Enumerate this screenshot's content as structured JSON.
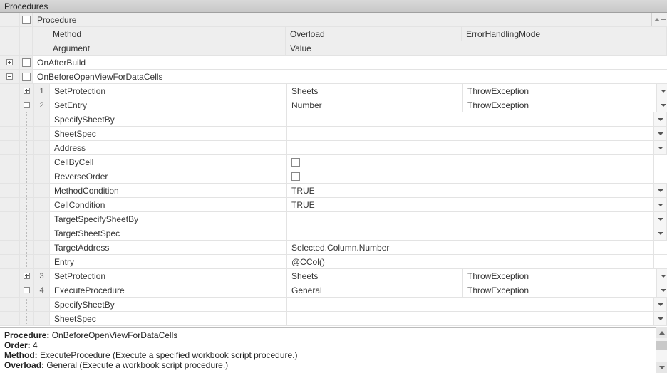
{
  "panel": {
    "title": "Procedures"
  },
  "headers": {
    "procedure": "Procedure",
    "method": "Method",
    "overload": "Overload",
    "error": "ErrorHandlingMode",
    "argument": "Argument",
    "value": "Value"
  },
  "groups": [
    {
      "name": "OnAfterBuild",
      "state": "collapsed",
      "checked": false
    },
    {
      "name": "OnBeforeOpenViewForDataCells",
      "state": "expanded",
      "checked": false
    }
  ],
  "steps": [
    {
      "num": "1",
      "method": "SetProtection",
      "overload": "Sheets",
      "error": "ThrowException",
      "state": "collapsed"
    },
    {
      "num": "2",
      "method": "SetEntry",
      "overload": "Number",
      "error": "ThrowException",
      "state": "expanded",
      "args": [
        {
          "name": "SpecifySheetBy",
          "value": "",
          "dd": true
        },
        {
          "name": "SheetSpec",
          "value": "",
          "dd": true
        },
        {
          "name": "Address",
          "value": "",
          "dd": true
        },
        {
          "name": "CellByCell",
          "value": "",
          "chk": true
        },
        {
          "name": "ReverseOrder",
          "value": "",
          "chk": true
        },
        {
          "name": "MethodCondition",
          "value": "TRUE",
          "dd": true
        },
        {
          "name": "CellCondition",
          "value": "TRUE",
          "dd": true
        },
        {
          "name": "TargetSpecifySheetBy",
          "value": "",
          "dd": true
        },
        {
          "name": "TargetSheetSpec",
          "value": "",
          "dd": true
        },
        {
          "name": "TargetAddress",
          "value": "Selected.Column.Number"
        },
        {
          "name": "Entry",
          "value": "@CCol()"
        }
      ]
    },
    {
      "num": "3",
      "method": "SetProtection",
      "overload": "Sheets",
      "error": "ThrowException",
      "state": "collapsed"
    },
    {
      "num": "4",
      "method": "ExecuteProcedure",
      "overload": "General",
      "error": "ThrowException",
      "state": "expanded",
      "args": [
        {
          "name": "SpecifySheetBy",
          "value": "",
          "dd": true
        },
        {
          "name": "SheetSpec",
          "value": "",
          "dd": true
        }
      ]
    }
  ],
  "detail": {
    "procedure_label": "Procedure:",
    "procedure": "OnBeforeOpenViewForDataCells",
    "order_label": "Order:",
    "order": "4",
    "method_label": "Method:",
    "method": "ExecuteProcedure (Execute a specified workbook script procedure.)",
    "overload_label": "Overload:",
    "overload": "General (Execute a workbook script procedure.)"
  }
}
